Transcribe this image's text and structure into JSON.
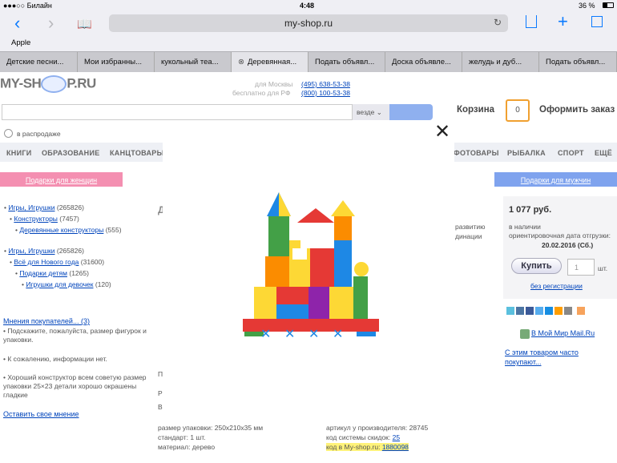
{
  "status": {
    "carrier": "●●●○○ Билайн",
    "time": "4:48",
    "battery": "36 %"
  },
  "browser": {
    "url": "my-shop.ru",
    "bookmark": "Apple"
  },
  "tabs": [
    {
      "label": "Детские песни..."
    },
    {
      "label": "Мои избранны..."
    },
    {
      "label": "кукольный теа..."
    },
    {
      "label": "Деревянная..."
    },
    {
      "label": "Подать объявл..."
    },
    {
      "label": "Доска объявле..."
    },
    {
      "label": "желудь и дуб..."
    },
    {
      "label": "Подать объявл..."
    }
  ],
  "header": {
    "logo_left": "MY-SH",
    "logo_right": "P.RU",
    "moscow_label": "для Москвы",
    "moscow_phone": "(495) 638-53-38",
    "rf_label": "бесплатно для РФ",
    "rf_phone": "(800) 100-53-38",
    "search_scope": "везде",
    "cart_label": "Корзина",
    "cart_count": "0",
    "checkout": "Оформить заказ",
    "sale_checkbox": "в распродаже"
  },
  "menu": {
    "left": [
      "КНИГИ",
      "ОБРАЗОВАНИЕ",
      "КАНЦТОВАРЫ"
    ],
    "right": [
      "ФОТОВАРЫ",
      "РЫБАЛКА",
      "СПОРТ",
      "ЕЩЁ"
    ]
  },
  "gifts": {
    "women": "Подарки для женщин",
    "men": "Подарки для мужчин"
  },
  "categories1": [
    {
      "label": "Игры, Игрушки",
      "count": "(265826)"
    },
    {
      "label": "Конструкторы",
      "count": "(7457)"
    },
    {
      "label": "Деревянные конструкторы",
      "count": "(555)"
    }
  ],
  "categories2": [
    {
      "label": "Игры, Игрушки",
      "count": "(265826)"
    },
    {
      "label": "Всё для Нового года",
      "count": "(31600)"
    },
    {
      "label": "Подарки детям",
      "count": "(1265)"
    },
    {
      "label": "Игрушки для девочек",
      "count": "(120)"
    }
  ],
  "reviews": {
    "link": "Мнения покупателей... (3)",
    "r1": "• Подскажите, пожалуйста, размер фигурок и упаковки.",
    "r2": "• К сожалению, информации нет.",
    "r3": "• Хороший конструктор всем советую размер упаковки 25×23 детали хорошо окрашены гладкие",
    "add": "Оставить свое мнение"
  },
  "product": {
    "price": "1 077 руб.",
    "availability": "в наличии",
    "ship_label": "ориентировочная дата отгрузки:",
    "ship_date": "20.02.2016 (Сб.)",
    "buy": "Купить",
    "qty": "1",
    "qty_unit": "шт.",
    "no_reg": "без регистрации",
    "mailru": "В Мой Мир Mail.Ru",
    "often": "С этим товаром часто покупают...",
    "desc_frag1": "развитию",
    "desc_frag2": "динации"
  },
  "details": {
    "size": "размер упаковки: 250x210x35 мм",
    "standard": "стандарт: 1 шт.",
    "material": "материал: дерево",
    "article": "артикул у производителя: 28745",
    "discount_label": "код системы скидок:",
    "discount_code": "25",
    "shop_code_label": "код в My-shop.ru:",
    "shop_code": "1880098"
  },
  "partial_letters": {
    "d": "Д",
    "p": "П",
    "r": "Р",
    "v": "В"
  },
  "colors": {
    "pink": "#f48fb1",
    "blue": "#7fa3ee",
    "link": "#0044bb",
    "orange": "#f0a030"
  }
}
